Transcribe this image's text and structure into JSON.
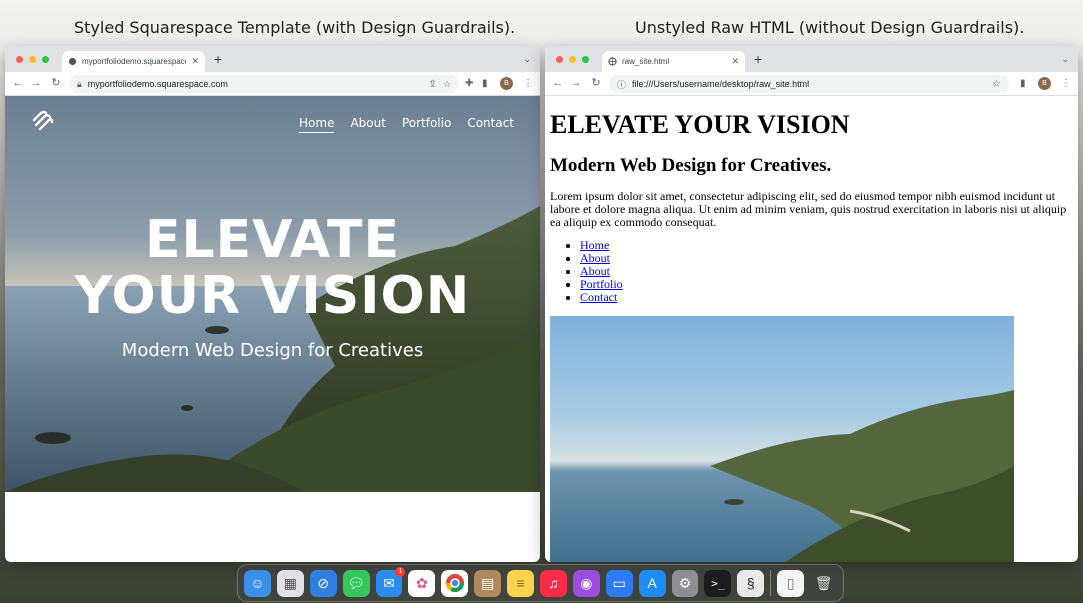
{
  "captions": {
    "left": "Styled Squarespace Template (with Design Guardrails).",
    "right": "Unstyled Raw HTML (without Design Guardrails)."
  },
  "left_browser": {
    "tab_title": "myportfoliodemo.squarespace",
    "url": "myportfoliodemo.squarespace.com",
    "nav": [
      "Home",
      "About",
      "Portfolio",
      "Contact"
    ],
    "active_nav": "Home",
    "hero_title_line1": "ELEVATE",
    "hero_title_line2": "YOUR VISION",
    "hero_subtitle": "Modern Web Design for Creatives",
    "avatar_letter": "B"
  },
  "right_browser": {
    "tab_title": "raw_site.html",
    "url": "file:///Users/username/desktop/raw_site.html",
    "h1": "ELEVATE YOUR VISION",
    "h2": "Modern Web Design for Creatives.",
    "paragraph": "Lorem ipsum dolor sit amet, consectetur adipiscing elit, sed do eiusmod tempor nibh euismod incidunt ut labore et dolore magna aliqua. Ut enim ad minim veniam, quis nostrud exercitation in laboris nisi ut aliquip ea aliquip ex commodo consequat.",
    "links": [
      "Home",
      "About",
      "About",
      "Portfolio",
      "Contact"
    ],
    "avatar_letter": "B"
  },
  "dock": {
    "apps": [
      "finder",
      "launchpad",
      "safari",
      "messages",
      "mail",
      "photos",
      "chrome",
      "notes-app",
      "notes",
      "music",
      "podcasts",
      "keynote",
      "app-store",
      "system-settings",
      "terminal",
      "squarespace",
      "document",
      "trash"
    ],
    "mail_badge": "1"
  },
  "colors": {
    "hero_text": "#ffffff",
    "link": "#0000ee",
    "tab_strip": "#dfe1e5"
  }
}
